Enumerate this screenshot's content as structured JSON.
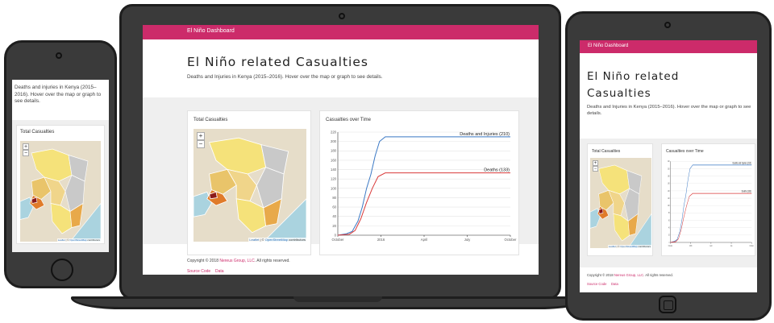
{
  "app": {
    "brand": "El Niño Dashboard",
    "title": "El Niño related Casualties",
    "title_line1": "El Niño related",
    "title_line2": "Casualties",
    "description": "Deaths and Injuries in Kenya (2015–2016). Hover over the map or graph to see details.",
    "phone_description": "Deaths and injuries in Kenya (2015–2016). Hover over the map or graph to see details."
  },
  "map_card": {
    "title": "Total Casualties",
    "zoom_in": "+",
    "zoom_out": "−",
    "attribution_leaflet": "Leaflet",
    "attribution_sep": " | © ",
    "attribution_osm": "OpenStreetMap",
    "attribution_tail": " contributors"
  },
  "chart_card": {
    "title": "Casualties over Time"
  },
  "footer": {
    "copyright_prefix": "Copyright © 2018 ",
    "company": "Nereus Group, LLC",
    "copyright_suffix": ". All rights reserved.",
    "source_code": "Source Code",
    "data": "Data"
  },
  "colors": {
    "brand": "#cc2b6a",
    "injuries_line": "#3a78c4",
    "deaths_line": "#d93a3a",
    "background_gray": "#efefef"
  },
  "chart_data": {
    "type": "line",
    "x_ticks": [
      "October",
      "2016",
      "April",
      "July",
      "October"
    ],
    "y_ticks": [
      0,
      20,
      40,
      60,
      80,
      100,
      120,
      140,
      160,
      180,
      200,
      220
    ],
    "ylim": [
      0,
      220
    ],
    "x_range_months": [
      0,
      12
    ],
    "series": [
      {
        "name": "Deaths and Injuries (210)",
        "color": "#3a78c4",
        "points": [
          [
            0,
            0
          ],
          [
            0.6,
            3
          ],
          [
            1.0,
            8
          ],
          [
            1.4,
            30
          ],
          [
            1.7,
            60
          ],
          [
            2.0,
            100
          ],
          [
            2.3,
            130
          ],
          [
            2.6,
            170
          ],
          [
            2.9,
            200
          ],
          [
            3.3,
            210
          ],
          [
            12,
            210
          ]
        ]
      },
      {
        "name": "Deaths (133)",
        "color": "#d93a3a",
        "points": [
          [
            0,
            0
          ],
          [
            0.8,
            2
          ],
          [
            1.2,
            10
          ],
          [
            1.6,
            35
          ],
          [
            2.0,
            70
          ],
          [
            2.4,
            100
          ],
          [
            2.8,
            125
          ],
          [
            3.3,
            133
          ],
          [
            12,
            133
          ]
        ]
      }
    ]
  }
}
